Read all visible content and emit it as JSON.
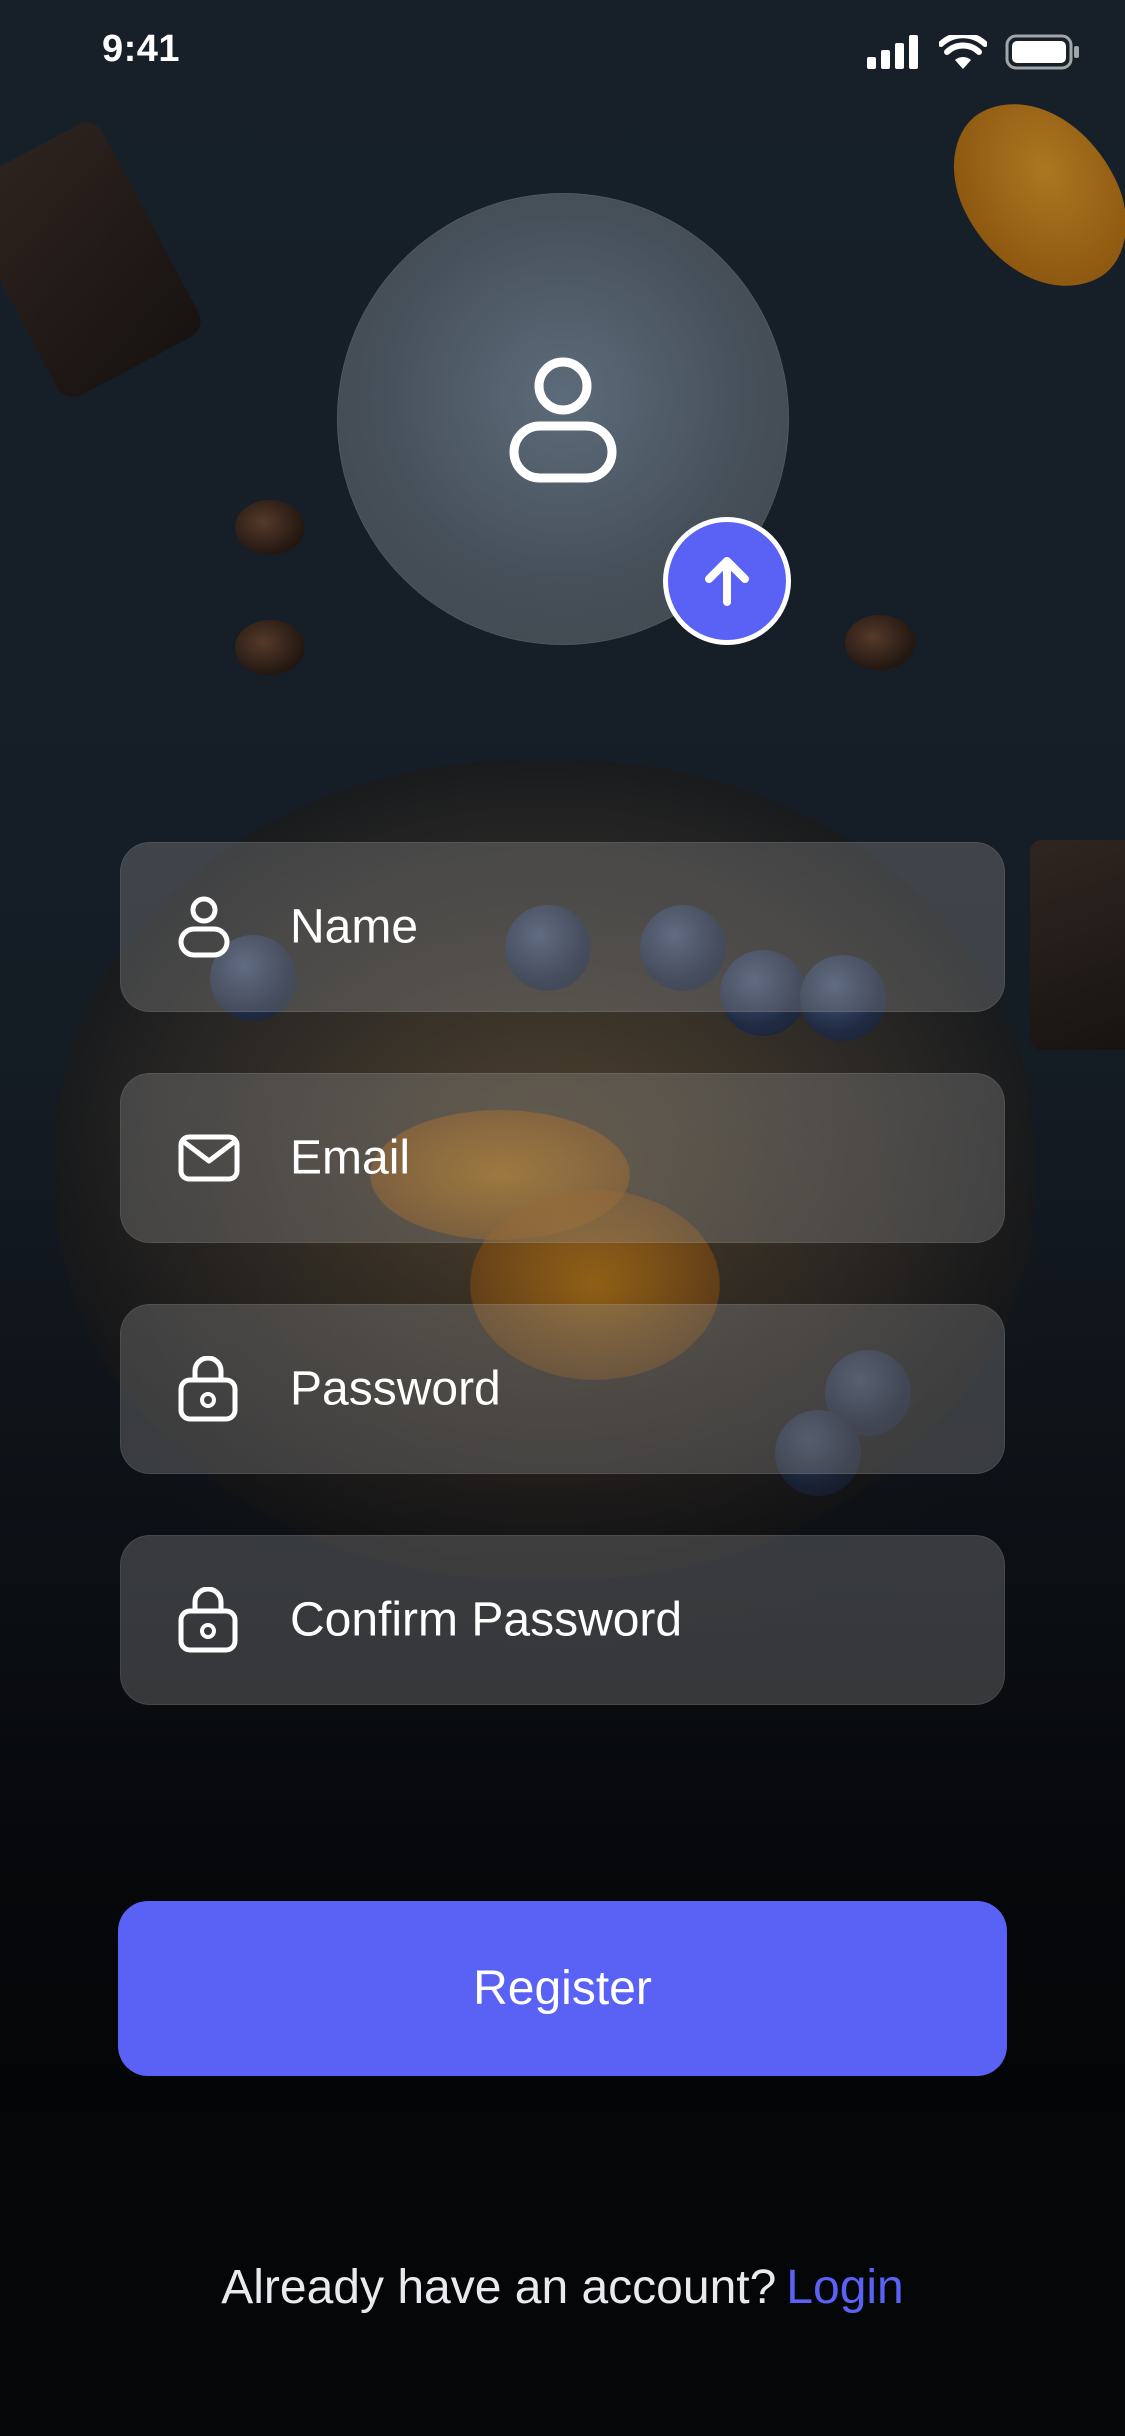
{
  "status_bar": {
    "time": "9:41",
    "icons": [
      "signal-icon",
      "wifi-icon",
      "battery-icon"
    ]
  },
  "avatar": {
    "icon": "person-icon",
    "upload_icon": "arrow-up-icon"
  },
  "form": {
    "fields": [
      {
        "icon": "person-icon",
        "placeholder": "Name"
      },
      {
        "icon": "envelope-icon",
        "placeholder": "Email"
      },
      {
        "icon": "lock-icon",
        "placeholder": "Password"
      },
      {
        "icon": "lock-icon",
        "placeholder": "Confirm Password"
      }
    ]
  },
  "actions": {
    "register_label": "Register"
  },
  "footer": {
    "prompt": "Already have an account?",
    "login_label": "Login"
  },
  "colors": {
    "accent": "#5a62f5",
    "text": "#ffffff"
  }
}
